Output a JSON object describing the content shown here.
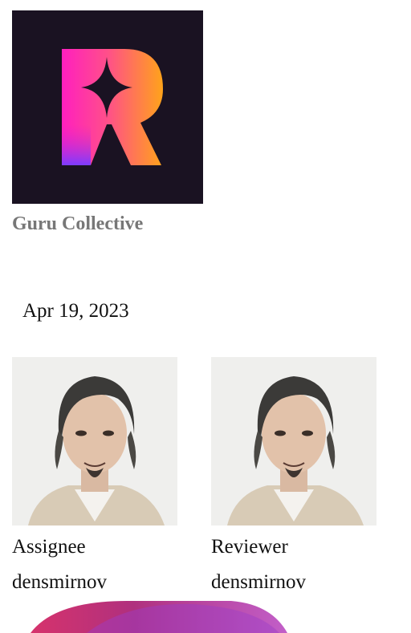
{
  "org": {
    "name": "Guru Collective",
    "logo_letter": "R",
    "logo_icon": "collective-logo-icon",
    "logo_bg": "#1a1222",
    "logo_gradient": [
      "#ff1fbf",
      "#ff5a7a",
      "#ffa31a"
    ]
  },
  "task": {
    "date": "Apr 19, 2023"
  },
  "people": [
    {
      "role": "Assignee",
      "username": "densmirnov",
      "avatar_icon": "user-avatar-photo"
    },
    {
      "role": "Reviewer",
      "username": "densmirnov",
      "avatar_icon": "user-avatar-photo"
    }
  ],
  "colors": {
    "org_name": "#777777",
    "text": "#111111",
    "accent_pink": "#d6336c",
    "accent_purple": "#9b3fc7"
  }
}
